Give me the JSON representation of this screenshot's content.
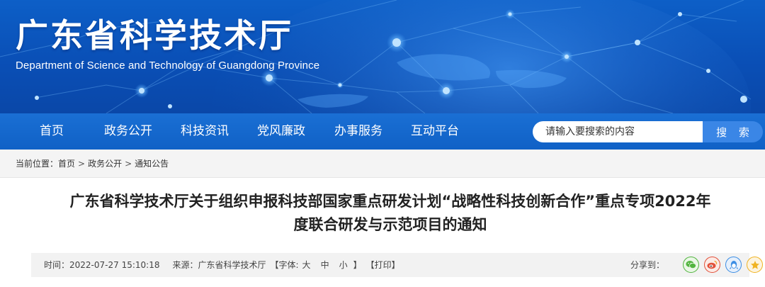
{
  "header": {
    "title": "广东省科学技术厅",
    "subtitle": "Department of Science and Technology of Guangdong Province"
  },
  "nav": {
    "items": [
      {
        "label": "首页"
      },
      {
        "label": "政务公开"
      },
      {
        "label": "科技资讯"
      },
      {
        "label": "党风廉政"
      },
      {
        "label": "办事服务"
      },
      {
        "label": "互动平台"
      }
    ]
  },
  "search": {
    "placeholder": "请输入要搜索的内容",
    "button_label": "搜 索"
  },
  "breadcrumb": {
    "prefix": "当前位置：",
    "items": [
      "首页",
      "政务公开",
      "通知公告"
    ],
    "separator": ">"
  },
  "article": {
    "title_line1": "广东省科学技术厅关于组织申报科技部国家重点研发计划“战略性科技创新合作”重点专项2022年",
    "title_line2": "度联合研发与示范项目的通知",
    "meta": {
      "time_label": "时间：",
      "time_value": "2022-07-27 15:10:18",
      "source_label": "来源：",
      "source_value": "广东省科学技术厅",
      "font_label": "【字体:",
      "font_large": "大",
      "font_medium": "中",
      "font_small": "小",
      "font_close": "】",
      "print_label": "【打印】",
      "share_label": "分享到："
    }
  },
  "share": [
    {
      "icon": "wechat-icon",
      "color": "#53b540"
    },
    {
      "icon": "weibo-icon",
      "color": "#e2513b"
    },
    {
      "icon": "qq-icon",
      "color": "#3d8ee4"
    },
    {
      "icon": "qzone-icon",
      "color": "#f0b323"
    }
  ],
  "colors": {
    "banner": "#0a4fb6",
    "nav": "#1061c6",
    "search_button": "#3a86e6",
    "breadcrumb_bg": "#f4f4f4",
    "meta_bg": "#f2f2f2"
  }
}
